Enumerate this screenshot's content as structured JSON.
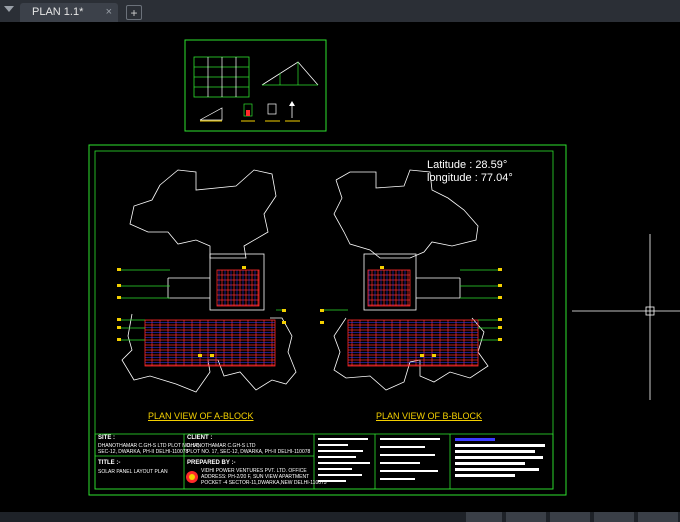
{
  "tabs": [
    {
      "label": "PLAN 1.1*",
      "close": "×"
    }
  ],
  "new_tab_label": "+",
  "drawing": {
    "latitude": "Latitude  :  28.59°",
    "longitude": "longitude : 77.04°",
    "label_a": "PLAN VIEW OF A-BLOCK",
    "label_b": "PLAN VIEW OF B-BLOCK"
  },
  "title_block": {
    "site_head": "SITE :",
    "site_text_1": "DHANOTHAMAR C.GH-S LTD PLOT NO. 17,",
    "site_text_2": "SEC-12, DWARKA, PH-II DELHI-110078",
    "client_head": "CLIENT :",
    "client_text_1": "DHANOTHAMAR C.GH-S LTD",
    "client_text_2": "PLOT NO. 17, SEC-12, DWARKA, PH-II DELHI-110078",
    "title_head": "TITLE :-",
    "title_text": "SOLAR PANEL LAYOUT PLAN",
    "prepared_head": "PREPARED BY :-",
    "prepared_text_1": "VIDHI POWER VENTURES PVT. LTD. OFFICE",
    "prepared_text_2": "ADDRESS: PH-2/20 F, SUN VIEW APARTMENT",
    "prepared_text_3": "POCKET -4 SECTOR-11,DWARKA,NEW DELHI-110075"
  },
  "colors": {
    "frame_green": "#2ee22e",
    "building_white": "#ffffff",
    "panel_red": "#ff2a2a",
    "panel_blue": "#3a3aff",
    "label_yellow": "#f4d000",
    "tabbar": "#2b2f36"
  },
  "icons": [
    "menu-icon",
    "close-icon",
    "plus-icon",
    "crosshair-icon"
  ]
}
